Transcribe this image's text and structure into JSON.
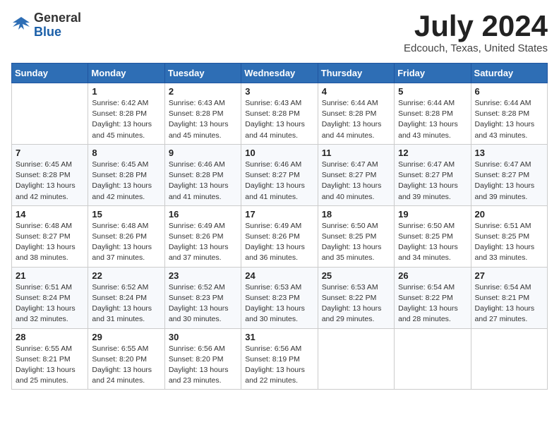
{
  "header": {
    "logo_general": "General",
    "logo_blue": "Blue",
    "month_title": "July 2024",
    "location": "Edcouch, Texas, United States"
  },
  "days_of_week": [
    "Sunday",
    "Monday",
    "Tuesday",
    "Wednesday",
    "Thursday",
    "Friday",
    "Saturday"
  ],
  "weeks": [
    [
      {
        "day": "",
        "sunrise": "",
        "sunset": "",
        "daylight": ""
      },
      {
        "day": "1",
        "sunrise": "Sunrise: 6:42 AM",
        "sunset": "Sunset: 8:28 PM",
        "daylight": "Daylight: 13 hours and 45 minutes."
      },
      {
        "day": "2",
        "sunrise": "Sunrise: 6:43 AM",
        "sunset": "Sunset: 8:28 PM",
        "daylight": "Daylight: 13 hours and 45 minutes."
      },
      {
        "day": "3",
        "sunrise": "Sunrise: 6:43 AM",
        "sunset": "Sunset: 8:28 PM",
        "daylight": "Daylight: 13 hours and 44 minutes."
      },
      {
        "day": "4",
        "sunrise": "Sunrise: 6:44 AM",
        "sunset": "Sunset: 8:28 PM",
        "daylight": "Daylight: 13 hours and 44 minutes."
      },
      {
        "day": "5",
        "sunrise": "Sunrise: 6:44 AM",
        "sunset": "Sunset: 8:28 PM",
        "daylight": "Daylight: 13 hours and 43 minutes."
      },
      {
        "day": "6",
        "sunrise": "Sunrise: 6:44 AM",
        "sunset": "Sunset: 8:28 PM",
        "daylight": "Daylight: 13 hours and 43 minutes."
      }
    ],
    [
      {
        "day": "7",
        "sunrise": "Sunrise: 6:45 AM",
        "sunset": "Sunset: 8:28 PM",
        "daylight": "Daylight: 13 hours and 42 minutes."
      },
      {
        "day": "8",
        "sunrise": "Sunrise: 6:45 AM",
        "sunset": "Sunset: 8:28 PM",
        "daylight": "Daylight: 13 hours and 42 minutes."
      },
      {
        "day": "9",
        "sunrise": "Sunrise: 6:46 AM",
        "sunset": "Sunset: 8:28 PM",
        "daylight": "Daylight: 13 hours and 41 minutes."
      },
      {
        "day": "10",
        "sunrise": "Sunrise: 6:46 AM",
        "sunset": "Sunset: 8:27 PM",
        "daylight": "Daylight: 13 hours and 41 minutes."
      },
      {
        "day": "11",
        "sunrise": "Sunrise: 6:47 AM",
        "sunset": "Sunset: 8:27 PM",
        "daylight": "Daylight: 13 hours and 40 minutes."
      },
      {
        "day": "12",
        "sunrise": "Sunrise: 6:47 AM",
        "sunset": "Sunset: 8:27 PM",
        "daylight": "Daylight: 13 hours and 39 minutes."
      },
      {
        "day": "13",
        "sunrise": "Sunrise: 6:47 AM",
        "sunset": "Sunset: 8:27 PM",
        "daylight": "Daylight: 13 hours and 39 minutes."
      }
    ],
    [
      {
        "day": "14",
        "sunrise": "Sunrise: 6:48 AM",
        "sunset": "Sunset: 8:27 PM",
        "daylight": "Daylight: 13 hours and 38 minutes."
      },
      {
        "day": "15",
        "sunrise": "Sunrise: 6:48 AM",
        "sunset": "Sunset: 8:26 PM",
        "daylight": "Daylight: 13 hours and 37 minutes."
      },
      {
        "day": "16",
        "sunrise": "Sunrise: 6:49 AM",
        "sunset": "Sunset: 8:26 PM",
        "daylight": "Daylight: 13 hours and 37 minutes."
      },
      {
        "day": "17",
        "sunrise": "Sunrise: 6:49 AM",
        "sunset": "Sunset: 8:26 PM",
        "daylight": "Daylight: 13 hours and 36 minutes."
      },
      {
        "day": "18",
        "sunrise": "Sunrise: 6:50 AM",
        "sunset": "Sunset: 8:25 PM",
        "daylight": "Daylight: 13 hours and 35 minutes."
      },
      {
        "day": "19",
        "sunrise": "Sunrise: 6:50 AM",
        "sunset": "Sunset: 8:25 PM",
        "daylight": "Daylight: 13 hours and 34 minutes."
      },
      {
        "day": "20",
        "sunrise": "Sunrise: 6:51 AM",
        "sunset": "Sunset: 8:25 PM",
        "daylight": "Daylight: 13 hours and 33 minutes."
      }
    ],
    [
      {
        "day": "21",
        "sunrise": "Sunrise: 6:51 AM",
        "sunset": "Sunset: 8:24 PM",
        "daylight": "Daylight: 13 hours and 32 minutes."
      },
      {
        "day": "22",
        "sunrise": "Sunrise: 6:52 AM",
        "sunset": "Sunset: 8:24 PM",
        "daylight": "Daylight: 13 hours and 31 minutes."
      },
      {
        "day": "23",
        "sunrise": "Sunrise: 6:52 AM",
        "sunset": "Sunset: 8:23 PM",
        "daylight": "Daylight: 13 hours and 30 minutes."
      },
      {
        "day": "24",
        "sunrise": "Sunrise: 6:53 AM",
        "sunset": "Sunset: 8:23 PM",
        "daylight": "Daylight: 13 hours and 30 minutes."
      },
      {
        "day": "25",
        "sunrise": "Sunrise: 6:53 AM",
        "sunset": "Sunset: 8:22 PM",
        "daylight": "Daylight: 13 hours and 29 minutes."
      },
      {
        "day": "26",
        "sunrise": "Sunrise: 6:54 AM",
        "sunset": "Sunset: 8:22 PM",
        "daylight": "Daylight: 13 hours and 28 minutes."
      },
      {
        "day": "27",
        "sunrise": "Sunrise: 6:54 AM",
        "sunset": "Sunset: 8:21 PM",
        "daylight": "Daylight: 13 hours and 27 minutes."
      }
    ],
    [
      {
        "day": "28",
        "sunrise": "Sunrise: 6:55 AM",
        "sunset": "Sunset: 8:21 PM",
        "daylight": "Daylight: 13 hours and 25 minutes."
      },
      {
        "day": "29",
        "sunrise": "Sunrise: 6:55 AM",
        "sunset": "Sunset: 8:20 PM",
        "daylight": "Daylight: 13 hours and 24 minutes."
      },
      {
        "day": "30",
        "sunrise": "Sunrise: 6:56 AM",
        "sunset": "Sunset: 8:20 PM",
        "daylight": "Daylight: 13 hours and 23 minutes."
      },
      {
        "day": "31",
        "sunrise": "Sunrise: 6:56 AM",
        "sunset": "Sunset: 8:19 PM",
        "daylight": "Daylight: 13 hours and 22 minutes."
      },
      {
        "day": "",
        "sunrise": "",
        "sunset": "",
        "daylight": ""
      },
      {
        "day": "",
        "sunrise": "",
        "sunset": "",
        "daylight": ""
      },
      {
        "day": "",
        "sunrise": "",
        "sunset": "",
        "daylight": ""
      }
    ]
  ]
}
